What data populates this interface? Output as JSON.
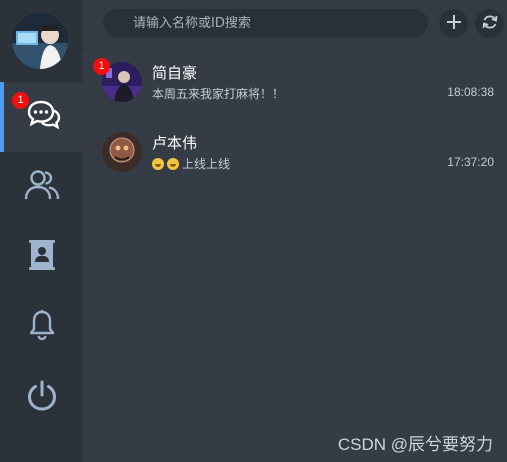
{
  "sidebar": {
    "user_avatar": "user-avatar",
    "nav": [
      {
        "name": "chat",
        "icon": "chat-bubbles-icon",
        "badge": "1",
        "active": true
      },
      {
        "name": "contacts",
        "icon": "users-icon"
      },
      {
        "name": "address-book",
        "icon": "contact-card-icon"
      },
      {
        "name": "notifications",
        "icon": "bell-icon"
      },
      {
        "name": "power",
        "icon": "power-icon"
      }
    ]
  },
  "search": {
    "placeholder": "请输入名称或ID搜索"
  },
  "toolbar": {
    "add_icon": "plus-icon",
    "refresh_icon": "refresh-icon"
  },
  "chats": [
    {
      "name": "简自豪",
      "message": "本周五来我家打麻将！！",
      "time": "18:08:38",
      "badge": "1"
    },
    {
      "name": "卢本伟",
      "message": "上线上线",
      "time": "17:37:20",
      "emoji_count": 2
    }
  ],
  "watermark": "CSDN @辰兮要努力",
  "colors": {
    "sidebar_bg": "#2b323a",
    "main_bg": "#353c45",
    "accent": "#4a9df8",
    "badge": "#f40d0d"
  }
}
